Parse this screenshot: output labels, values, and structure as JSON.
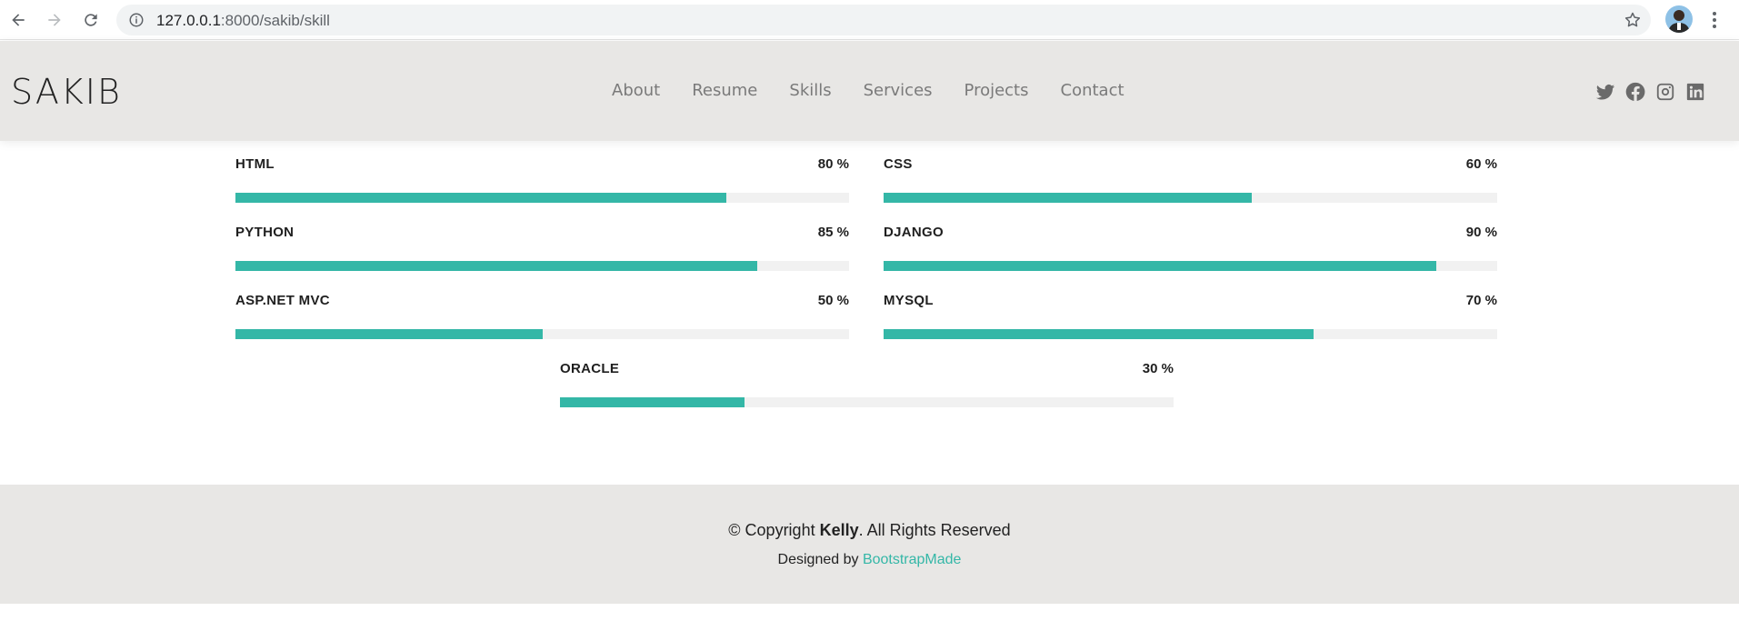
{
  "browser": {
    "url_host": "127.0.0.1",
    "url_rest": ":8000/sakib/skill"
  },
  "header": {
    "logo": "SAKIB",
    "menu": [
      "About",
      "Resume",
      "Skills",
      "Services",
      "Projects",
      "Contact"
    ],
    "socials": [
      "twitter-icon",
      "facebook-icon",
      "instagram-icon",
      "linkedin-icon"
    ]
  },
  "skills": [
    {
      "name": "HTML",
      "percent_label": "80 %",
      "value": 80
    },
    {
      "name": "CSS",
      "percent_label": "60 %",
      "value": 60
    },
    {
      "name": "PYTHON",
      "percent_label": "85 %",
      "value": 85
    },
    {
      "name": "DJANGO",
      "percent_label": "90 %",
      "value": 90
    },
    {
      "name": "ASP.NET MVC",
      "percent_label": "50 %",
      "value": 50
    },
    {
      "name": "MYSQL",
      "percent_label": "70 %",
      "value": 70
    },
    {
      "name": "ORACLE",
      "percent_label": "30 %",
      "value": 30
    }
  ],
  "footer": {
    "copyright_prefix": "© Copyright ",
    "copyright_name": "Kelly",
    "copyright_suffix": ". All Rights Reserved",
    "designed_by": "Designed by ",
    "designer_link": "BootstrapMade"
  },
  "colors": {
    "accent": "#34b7a7",
    "header_bg": "#e8e7e5",
    "track": "#f1f1f1"
  }
}
